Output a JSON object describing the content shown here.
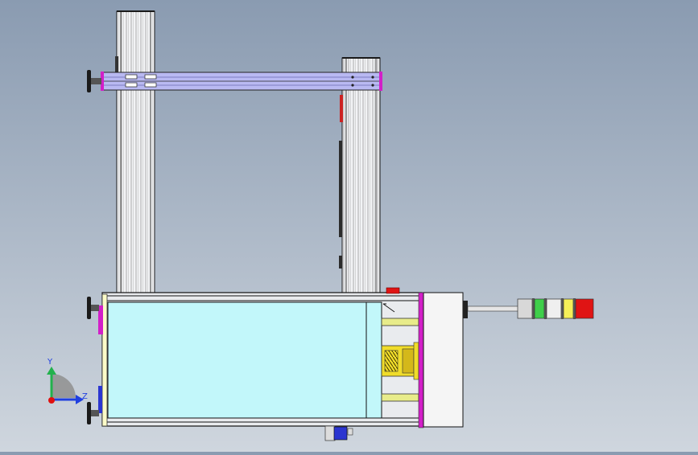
{
  "viewport": {
    "background_top": "#8a9bb1",
    "background_bottom": "#cfd6de"
  },
  "triad": {
    "y_label": "Y",
    "z_label": "Z",
    "y_color": "#22b14c",
    "z_color": "#1f3fe0",
    "origin_color": "#e01010"
  },
  "colors": {
    "extrusion": "#f2f3f5",
    "crossbeam": "#b9b9f2",
    "magenta_plate": "#d21fc8",
    "tank": "#c2f7fa",
    "guide_rod": "#e8ec8a",
    "screw_block": "#f0dc2a",
    "side_plate": "#fbfbc8"
  },
  "stack_light": {
    "segments": [
      {
        "name": "gray",
        "color": "#d8d8d8"
      },
      {
        "name": "green",
        "color": "#3fcf4a"
      },
      {
        "name": "white",
        "color": "#efefef"
      },
      {
        "name": "yellow",
        "color": "#f5ef58"
      },
      {
        "name": "red",
        "color": "#e01414"
      }
    ]
  }
}
